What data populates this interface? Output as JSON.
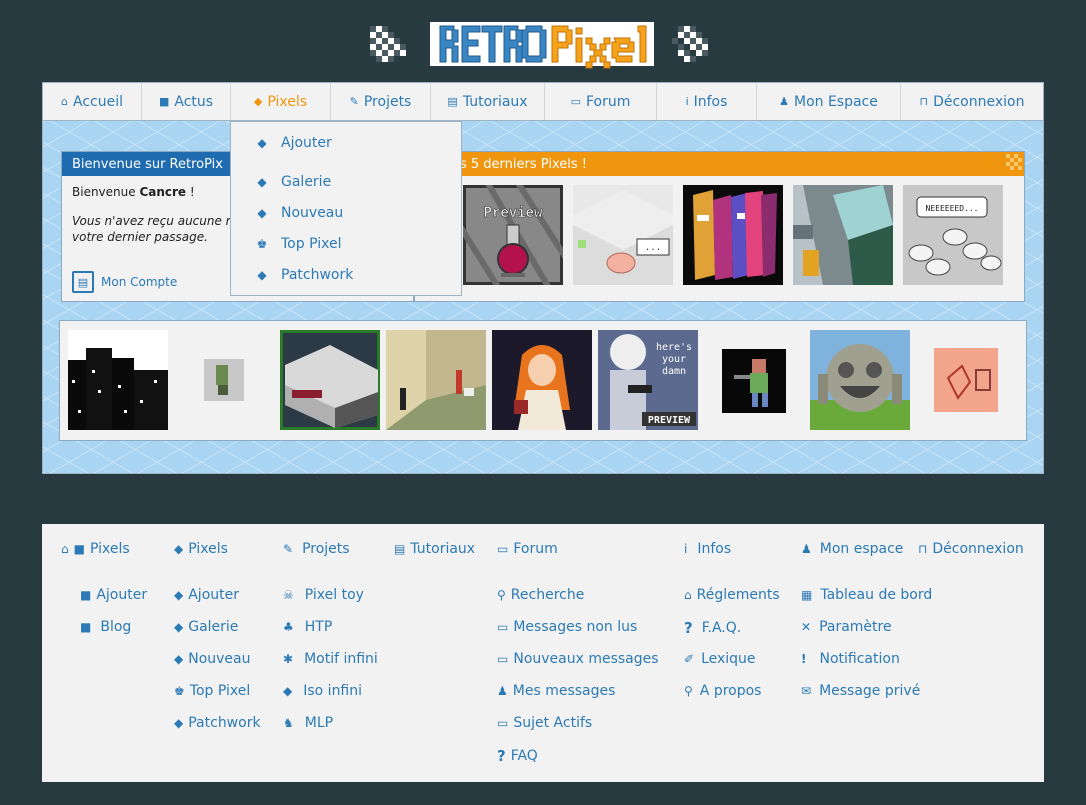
{
  "logo": {
    "text": "RetroPixel"
  },
  "nav": [
    {
      "icon": "house-icon",
      "glyph": "⌂",
      "label": "Accueil"
    },
    {
      "icon": "newspaper-icon",
      "glyph": "■",
      "label": "Actus"
    },
    {
      "icon": "cube-icon",
      "glyph": "◆",
      "label": "Pixels",
      "active": true
    },
    {
      "icon": "pencil-icon",
      "glyph": "✎",
      "label": "Projets"
    },
    {
      "icon": "film-icon",
      "glyph": "▤",
      "label": "Tutoriaux"
    },
    {
      "icon": "speech-bubble-icon",
      "glyph": "▭",
      "label": "Forum"
    },
    {
      "icon": "info-icon",
      "glyph": "i",
      "label": "Infos"
    },
    {
      "icon": "person-icon",
      "glyph": "♟",
      "label": "Mon Espace"
    },
    {
      "icon": "unlock-icon",
      "glyph": "⊓",
      "label": "Déconnexion"
    }
  ],
  "welcome": {
    "title": "Bienvenue sur RetroPix",
    "greet_prefix": "Bienvenue ",
    "user": "Cancre",
    "greet_suffix": " !",
    "message": "Vous n'avez reçu aucune m\nvotre dernier passage.",
    "account_label": "Mon Compte"
  },
  "latest": {
    "title": "es 5 derniers Pixels !"
  },
  "dropdown": [
    {
      "icon": "cube-plus-icon",
      "glyph": "◆",
      "label": "Ajouter"
    },
    {
      "icon": "cube-icon",
      "glyph": "◆",
      "label": "Galerie"
    },
    {
      "icon": "new-cube-icon",
      "glyph": "◆",
      "label": "Nouveau"
    },
    {
      "icon": "trophy-icon",
      "glyph": "♚",
      "label": "Top Pixel"
    },
    {
      "icon": "cubes-icon",
      "glyph": "◆",
      "label": "Patchwork"
    }
  ],
  "footer": {
    "col1": {
      "header": "Pixels",
      "items": [
        "Ajouter",
        "Blog"
      ]
    },
    "col2": {
      "header": "Pixels",
      "items": [
        "Ajouter",
        "Galerie",
        "Nouveau",
        "Top Pixel",
        "Patchwork"
      ]
    },
    "col3": {
      "header": "Projets",
      "items": [
        "Pixel toy",
        "HTP",
        "Motif infini",
        "Iso infini",
        "MLP"
      ]
    },
    "col4": {
      "header": "Tutoriaux",
      "items": []
    },
    "col5": {
      "header": "Forum",
      "items": [
        "Recherche",
        "Messages non lus",
        "Nouveaux messages",
        "Mes messages",
        "Sujet Actifs",
        "FAQ"
      ]
    },
    "col6": {
      "header": "Infos",
      "items": [
        "Réglements",
        "F.A.Q.",
        "Lexique",
        "A propos"
      ]
    },
    "col7": {
      "header": "Mon espace",
      "items": []
    },
    "col8": {
      "header": "Déconnexion",
      "items": [
        "Tableau de bord",
        "Paramètre",
        "Notification",
        "Message privé"
      ]
    }
  },
  "thumb_preview_text": "Preview",
  "thumb_speech_text": "NEEEEEED...",
  "thumb_heres_text": "here's\nyour\ndamn",
  "thumb_preview2_text": "PREVIEW",
  "colors": {
    "link": "#2c7ab5",
    "accent": "#f0960e",
    "header_blue": "#1f6bb0",
    "bg": "#263a3f"
  }
}
